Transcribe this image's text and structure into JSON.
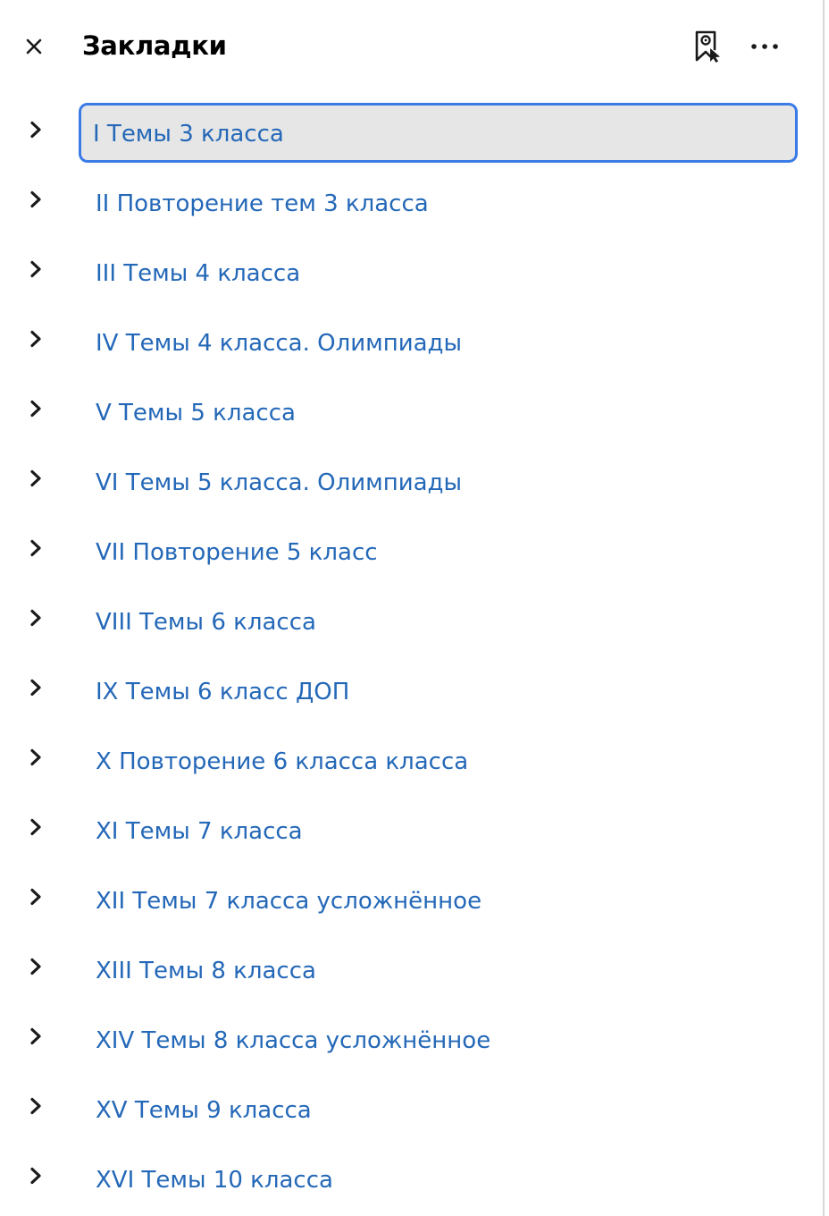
{
  "header": {
    "title": "Закладки",
    "close_icon": "close-icon",
    "bookmark_action_icon": "bookmark-add-icon",
    "more_icon": "more-horizontal-icon"
  },
  "colors": {
    "link": "#2468b8",
    "selected_bg": "#e6e6e6",
    "focus_border": "#3b7be6",
    "text": "#000000"
  },
  "bookmarks": [
    {
      "label": "I Темы 3 класса",
      "selected": true
    },
    {
      "label": "II Повторение тем 3 класса",
      "selected": false
    },
    {
      "label": "III Темы 4 класса",
      "selected": false
    },
    {
      "label": "IV Темы 4 класса. Олимпиады",
      "selected": false
    },
    {
      "label": "V Темы 5 класса",
      "selected": false
    },
    {
      "label": "VI Темы 5 класса. Олимпиады",
      "selected": false
    },
    {
      "label": "VII Повторение 5 класс",
      "selected": false
    },
    {
      "label": "VIII Темы 6 класса",
      "selected": false
    },
    {
      "label": "IX Темы 6 класс ДОП",
      "selected": false
    },
    {
      "label": "X Повторение 6 класса класса",
      "selected": false
    },
    {
      "label": "XI Темы 7 класса",
      "selected": false
    },
    {
      "label": "XII Темы 7 класса усложнённое",
      "selected": false
    },
    {
      "label": "XIII Темы 8 класса",
      "selected": false
    },
    {
      "label": "XIV Темы 8 класса усложнённое",
      "selected": false
    },
    {
      "label": "XV Темы 9 класса",
      "selected": false
    },
    {
      "label": "XVI Темы 10 класса",
      "selected": false
    }
  ]
}
